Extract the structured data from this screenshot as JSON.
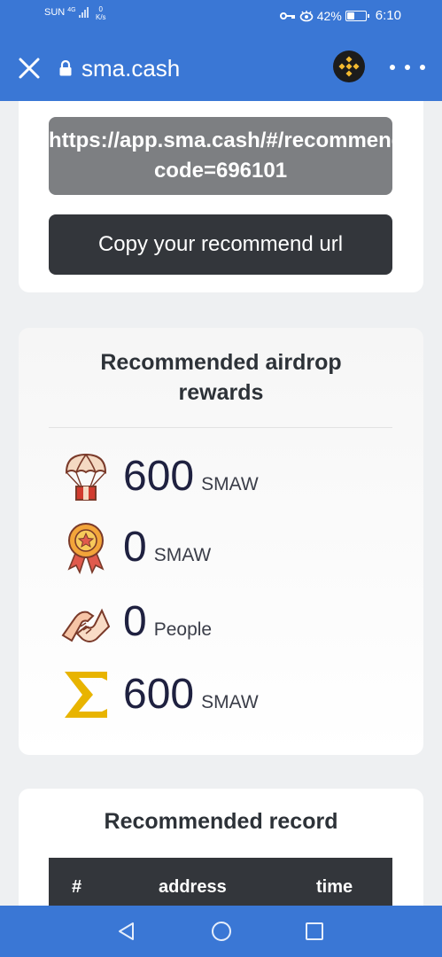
{
  "status_bar": {
    "carrier": "SUN",
    "network": "4G",
    "netspeed_value": "0",
    "netspeed_unit": "K/s",
    "battery_percent": "42%",
    "battery_level": 0.42,
    "time": "6:10"
  },
  "browser": {
    "title": "sma.cash"
  },
  "referral": {
    "url_line1": "https://app.sma.cash/#/recommend?",
    "url_line2": "code=696101",
    "copy_label": "Copy your recommend url"
  },
  "rewards": {
    "title_line1": "Recommended airdrop",
    "title_line2": "rewards",
    "items": [
      {
        "icon": "airdrop-parachute-icon",
        "value": "600",
        "unit": "SMAW"
      },
      {
        "icon": "medal-icon",
        "value": "0",
        "unit": "SMAW"
      },
      {
        "icon": "handshake-icon",
        "value": "0",
        "unit": "People"
      },
      {
        "icon": "sigma-icon",
        "value": "600",
        "unit": "SMAW"
      }
    ]
  },
  "records": {
    "title": "Recommended record",
    "columns": [
      "#",
      "address",
      "time"
    ]
  },
  "colors": {
    "header_blue": "#3a77d5",
    "dark_button": "#33363b",
    "url_box_gray": "#7d7f82",
    "sigma_gold": "#e8b400"
  }
}
